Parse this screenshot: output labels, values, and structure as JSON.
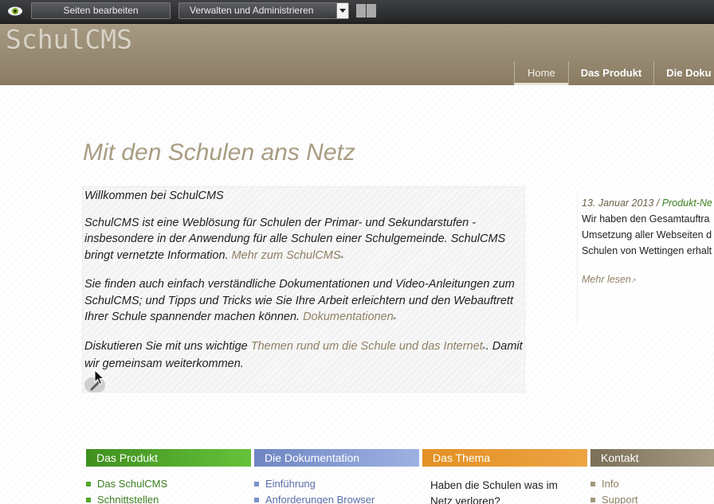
{
  "toolbar": {
    "edit_pages_label": "Seiten bearbeiten",
    "manage_select_value": "Verwalten und Administrieren",
    "icons": [
      "eye-icon",
      "chevron-down-icon"
    ]
  },
  "header": {
    "logo": "SchulCMS",
    "nav": [
      {
        "label": "Home",
        "active": true
      },
      {
        "label": "Das Produkt",
        "active": false
      },
      {
        "label": "Die Doku",
        "active": false
      }
    ]
  },
  "main": {
    "title": "Mit den Schulen ans Netz",
    "intro": {
      "welcome": "Willkommen bei SchulCMS",
      "p1": "SchulCMS ist eine Weblösung für Schulen der Primar- und Sekundarstufen - insbesondere in der Anwendung für alle Schulen einer Schulgemeinde. SchulCMS bringt vernetzte Information.",
      "p1_link": "Mehr zum SchulCMS",
      "p2": "Sie finden auch einfach verständliche Dokumentationen und Video-Anleitungen zum SchulCMS; und Tipps und Tricks wie Sie Ihre Arbeit erleichtern und den Webauftrett Ihrer Schule spannender machen können.",
      "p2_link": "Dokumentationen",
      "p3_start": "Diskutieren Sie mit uns wichtige",
      "p3_link": "Themen rund um die Schule und das Internet",
      "p3_end": ". Damit wir gemeinsam weiterkommen."
    },
    "news": {
      "date": "13. Januar 2013",
      "separator": " / ",
      "category": "Produkt-Ne",
      "lines": [
        "Wir haben den Gesamtauftra",
        "Umsetzung aller Webseiten d",
        "Schulen von Wettingen erhalt"
      ],
      "more": "Mehr lesen"
    }
  },
  "columns": [
    {
      "heading": "Das Produkt",
      "items": [
        "Das SchulCMS",
        "Schnittstellen"
      ]
    },
    {
      "heading": "Die Dokumentation",
      "items": [
        "Einführung",
        "Anforderungen Browser"
      ]
    },
    {
      "heading": "Das Thema",
      "text_lines": [
        "Haben die Schulen was im",
        "Netz verloren?"
      ]
    },
    {
      "heading": "Kontakt",
      "items": [
        "Info",
        "Support"
      ]
    }
  ],
  "colors": {
    "header_bg": "#9a8c72",
    "title": "#a89c82",
    "link": "#8f8164",
    "green": "#4fa62a",
    "blue": "#7a90cc",
    "orange": "#e39024",
    "taupe": "#7b6f58"
  }
}
